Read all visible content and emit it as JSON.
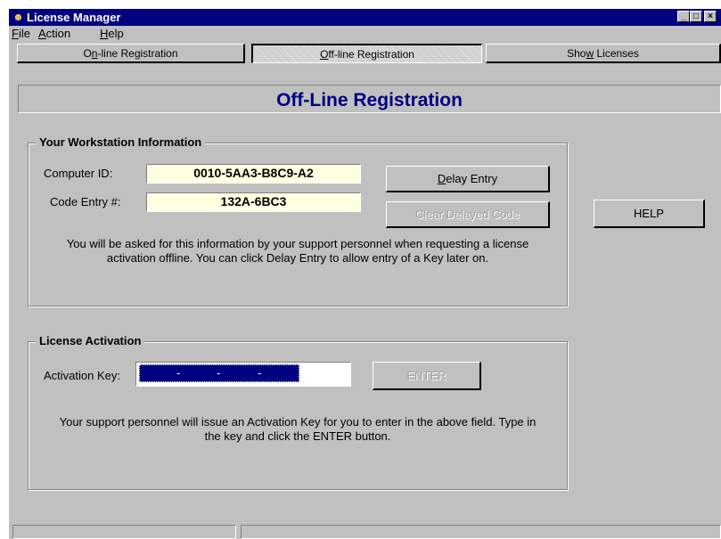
{
  "window": {
    "title": "License Manager",
    "app_icon": "license-manager-icon",
    "controls": {
      "minimize": "_",
      "maximize": "□",
      "close": "×"
    }
  },
  "menu": {
    "file": {
      "mnemonic": "F",
      "rest": "ile"
    },
    "action": {
      "mnemonic": "A",
      "rest": "ction"
    },
    "help": {
      "mnemonic": "H",
      "rest": "elp"
    }
  },
  "tabs": {
    "online": {
      "pre": "O",
      "mnemonic": "n",
      "post": "-line Registration"
    },
    "offline": {
      "pre": "",
      "mnemonic": "O",
      "post": "ff-line Registration"
    },
    "licenses": {
      "pre": "Sho",
      "mnemonic": "w",
      "post": " Licenses"
    }
  },
  "page_title": "Off-Line Registration",
  "workstation": {
    "legend": "Your Workstation Information",
    "computer_id_label": "Computer ID:",
    "computer_id": "0010-5AA3-B8C9-A2",
    "code_entry_label": "Code Entry #:",
    "code_entry": "132A-6BC3",
    "delay_button": {
      "mnemonic": "D",
      "rest": "elay Entry"
    },
    "clear_button": "Clear Delayed Code",
    "info_line1": "You will be asked for this information by your support personnel when requesting a license",
    "info_line2": "activation offline. You can click Delay Entry to allow entry of a Key later on."
  },
  "help_button": "HELP",
  "activation": {
    "legend": "License Activation",
    "key_label": "Activation Key:",
    "key_separators": [
      "-",
      "-",
      "-"
    ],
    "enter_button": "ENTER",
    "info_line1": "Your support personnel will issue an Activation Key for you to enter in the above field. Type in",
    "info_line2": "the key and click the ENTER button."
  },
  "status": {
    "panel1": "",
    "panel2": ""
  },
  "colors": {
    "title_bar": "#000080",
    "page_title": "#000080",
    "face": "#c0c0c0",
    "value_box": "#ffffe1",
    "selection": "#000080"
  }
}
